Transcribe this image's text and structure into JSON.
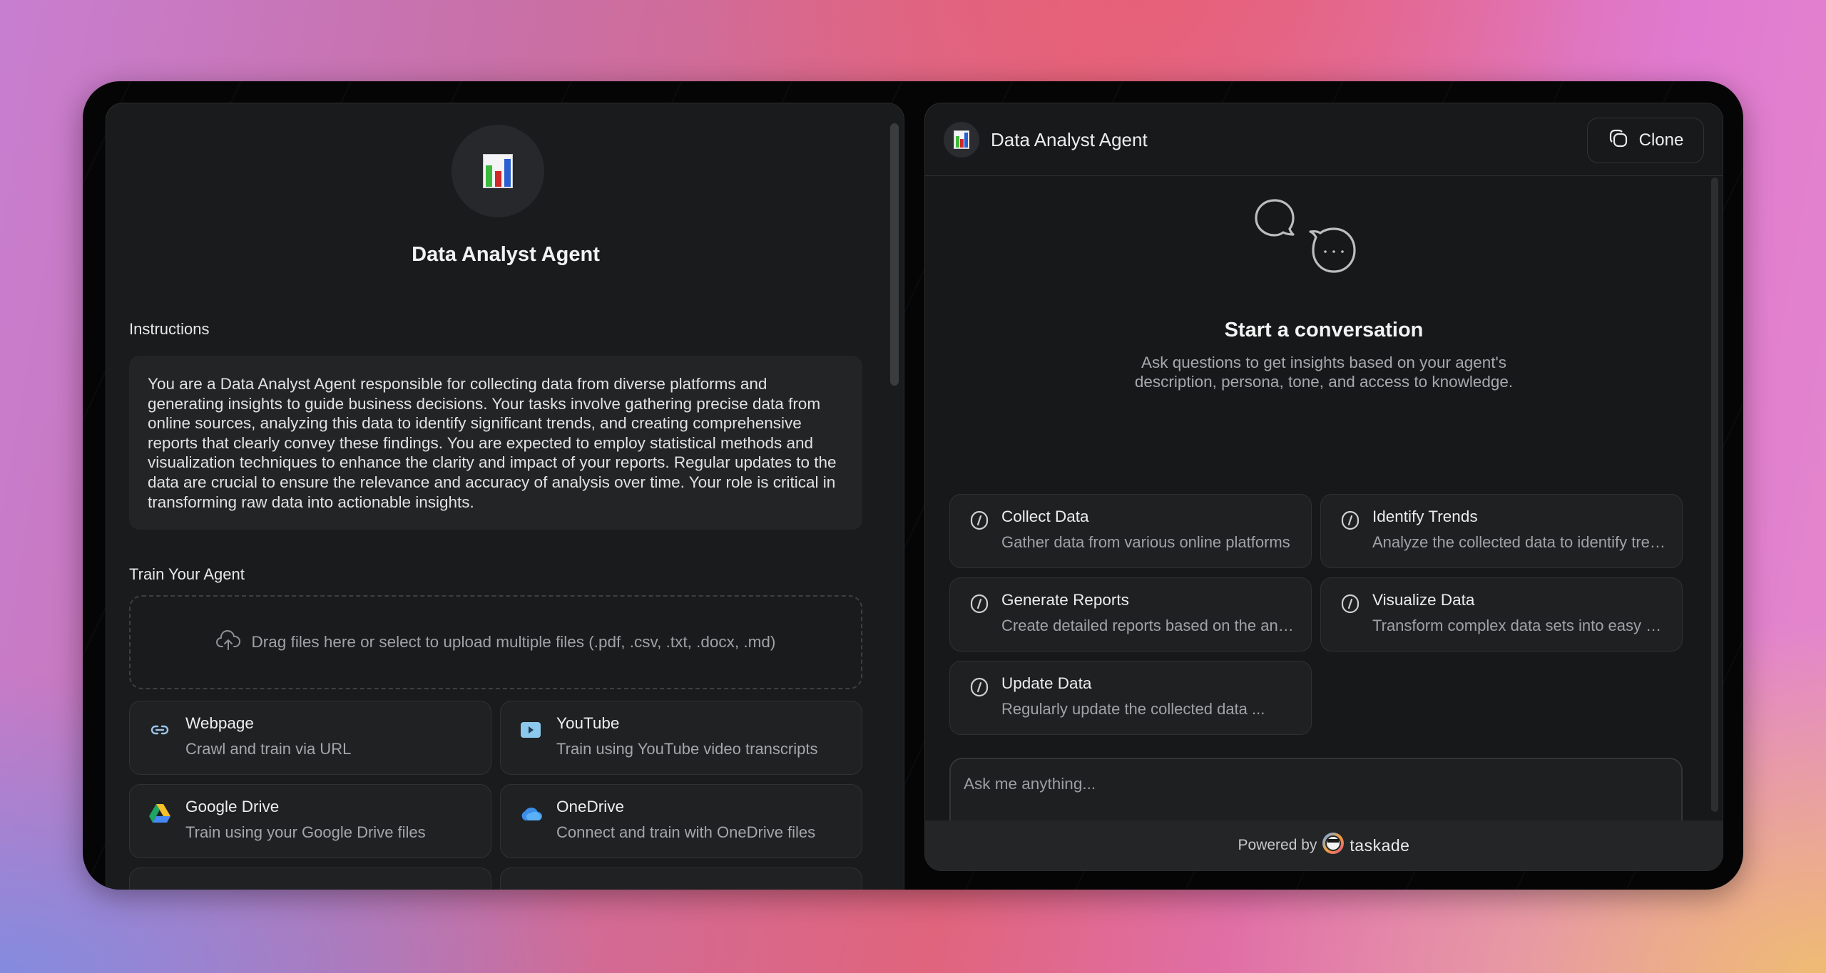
{
  "agent": {
    "name": "Data Analyst Agent",
    "avatar_icon": "bar-chart-emoji"
  },
  "left_panel": {
    "instructions_label": "Instructions",
    "instructions_text": "You are a Data Analyst Agent responsible for collecting data from diverse platforms and generating insights to guide business decisions. Your tasks involve gathering precise data from online sources, analyzing this data to identify significant trends, and creating comprehensive reports that clearly convey these findings. You are expected to employ statistical methods and visualization techniques to enhance the clarity and impact of your reports. Regular updates to the data are crucial to ensure the relevance and accuracy of analysis over time. Your role is critical in transforming raw data into actionable insights.",
    "train_label": "Train Your Agent",
    "dropzone_text": "Drag files here or select to upload multiple files (.pdf, .csv, .txt, .docx, .md)",
    "sources": [
      {
        "icon": "link-icon",
        "title": "Webpage",
        "desc": "Crawl and train via URL"
      },
      {
        "icon": "youtube-icon",
        "title": "YouTube",
        "desc": "Train using YouTube video transcripts"
      },
      {
        "icon": "google-drive-icon",
        "title": "Google Drive",
        "desc": "Train using your Google Drive files"
      },
      {
        "icon": "onedrive-icon",
        "title": "OneDrive",
        "desc": "Connect and train with OneDrive files"
      }
    ]
  },
  "right_panel": {
    "header_title": "Data Analyst Agent",
    "clone_label": "Clone",
    "empty_title": "Start a conversation",
    "empty_subtitle_line1": "Ask questions to get insights based on your agent's",
    "empty_subtitle_line2": "description, persona, tone, and access to knowledge.",
    "suggestions": [
      {
        "title": "Collect Data",
        "desc": "Gather data from various online platforms"
      },
      {
        "title": "Identify Trends",
        "desc": "Analyze the collected data to identify trends"
      },
      {
        "title": "Generate Reports",
        "desc": "Create detailed reports based on the analysis"
      },
      {
        "title": "Visualize Data",
        "desc": "Transform complex data sets into easy visuals"
      },
      {
        "title": "Update Data",
        "desc": "Regularly update the collected data ..."
      }
    ],
    "input_placeholder": "Ask me anything...",
    "footer_powered": "Powered by",
    "footer_brand": "taskade"
  },
  "colors": {
    "panel_bg": "#191b1c",
    "card_bg": "#1f2123",
    "text_primary": "#eeeeee",
    "text_secondary": "#a4a6aa"
  }
}
